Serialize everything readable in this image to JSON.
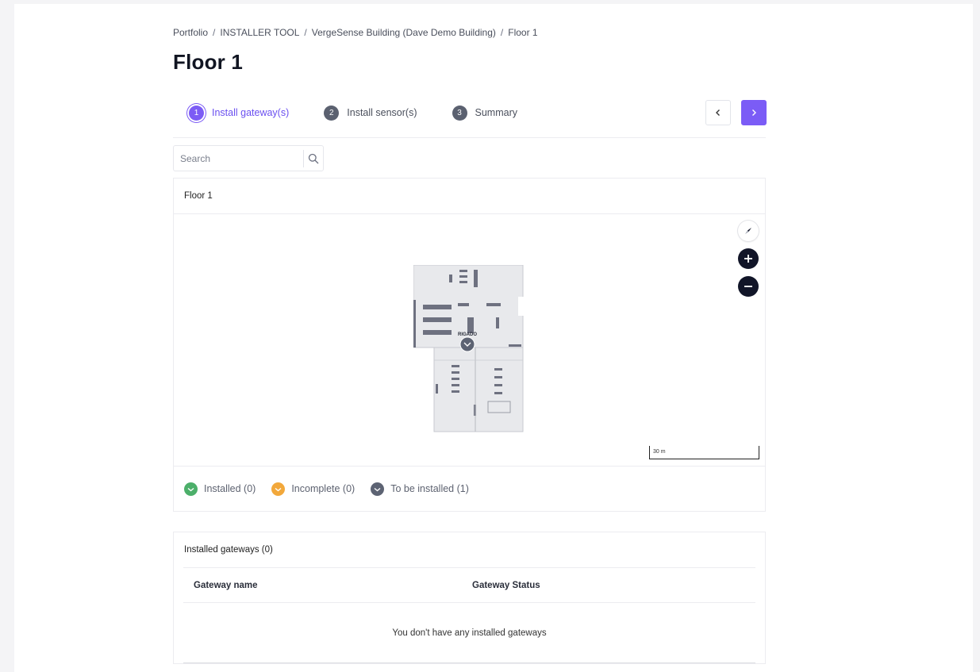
{
  "breadcrumb": {
    "items": [
      "Portfolio",
      "INSTALLER TOOL",
      "VergeSense Building (Dave Demo Building)"
    ],
    "separator": "/",
    "current": "Floor 1"
  },
  "page_title": "Floor 1",
  "stepper": {
    "steps": [
      {
        "num": "1",
        "label": "Install gateway(s)"
      },
      {
        "num": "2",
        "label": "Install sensor(s)"
      },
      {
        "num": "3",
        "label": "Summary"
      }
    ],
    "active_step": "1"
  },
  "nav": {
    "prev_icon": "chevron-left-icon",
    "next_icon": "chevron-right-icon"
  },
  "search": {
    "placeholder": "Search",
    "value": "",
    "icon": "search-icon"
  },
  "map": {
    "header": "Floor 1",
    "gateway_label": "RIGADO",
    "scale_label": "30 m",
    "controls": [
      "compass-icon",
      "zoom-in-icon",
      "zoom-out-icon"
    ]
  },
  "legend": [
    {
      "label": "Installed (0)",
      "color": "#4caf6a"
    },
    {
      "label": "Incomplete (0)",
      "color": "#f2a83b"
    },
    {
      "label": "To be installed (1)",
      "color": "#5d6373"
    }
  ],
  "gateways": {
    "title": "Installed gateways (0)",
    "columns": [
      "Gateway name",
      "Gateway Status"
    ],
    "empty_message": "You don't have any installed gateways"
  },
  "colors": {
    "accent": "#7b5cf6",
    "dark": "#111528"
  }
}
